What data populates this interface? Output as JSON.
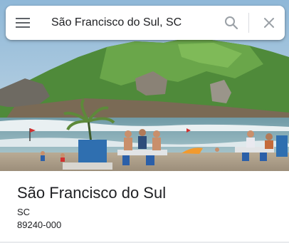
{
  "search": {
    "query": "São Francisco do Sul, SC",
    "menu_icon": "menu-icon",
    "search_icon": "search-icon",
    "close_icon": "close-icon"
  },
  "place": {
    "title": "São Francisco do Sul",
    "state": "SC",
    "postal_code": "89240-000"
  },
  "colors": {
    "text": "#202124",
    "icon": "#5f6368",
    "icon_light": "#9aa0a6"
  }
}
